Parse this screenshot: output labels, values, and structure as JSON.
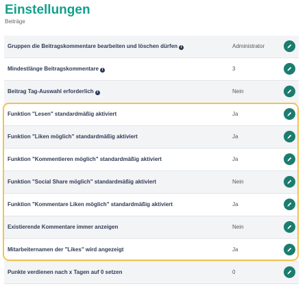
{
  "page": {
    "title": "Einstellungen",
    "subtitle": "Beiträge"
  },
  "settings": [
    {
      "label": "Gruppen die Beitragskommentare bearbeiten und löschen dürfen",
      "value": "Administrator",
      "info": true
    },
    {
      "label": "Mindestlänge Beitragskommentare",
      "value": "3",
      "info": true
    },
    {
      "label": "Beitrag Tag-Auswahl erforderlich",
      "value": "Nein",
      "info": true
    },
    {
      "label": "Funktion \"Lesen\" standardmäßig aktiviert",
      "value": "Ja",
      "info": false
    },
    {
      "label": "Funktion \"Liken möglich\" standardmäßig aktiviert",
      "value": "Ja",
      "info": false
    },
    {
      "label": "Funktion \"Kommentieren möglich\" standardmäßig aktiviert",
      "value": "Ja",
      "info": false
    },
    {
      "label": "Funktion \"Social Share möglich\" standardmäßig aktiviert",
      "value": "Nein",
      "info": false
    },
    {
      "label": "Funktion \"Kommentare Liken möglich\" standardmäßig aktiviert",
      "value": "Ja",
      "info": false
    },
    {
      "label": "Existierende Kommentare immer anzeigen",
      "value": "Nein",
      "info": false
    },
    {
      "label": "Mitarbeiternamen der \"Likes\" wird angezeigt",
      "value": "Ja",
      "info": false
    },
    {
      "label": "Punkte verdienen nach x Tagen auf 0 setzen",
      "value": "0",
      "info": false
    }
  ],
  "icons": {
    "edit": "pencil-icon",
    "info": "info-icon"
  },
  "colors": {
    "accent": "#12a08c",
    "edit_button": "#1b7d6f",
    "highlight_border": "#f2c34e",
    "label_text": "#2e3a55"
  }
}
